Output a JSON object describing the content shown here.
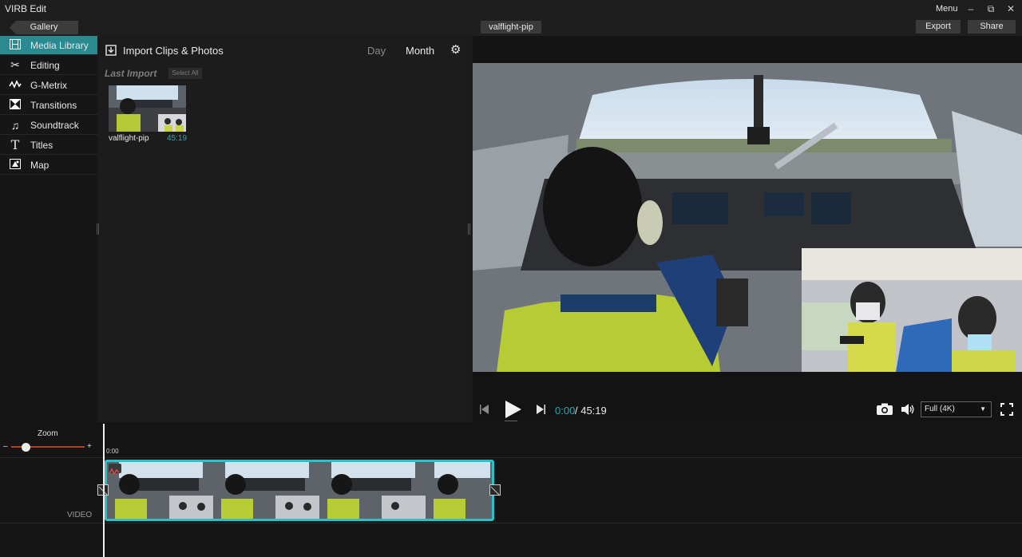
{
  "app": {
    "title": "VIRB Edit",
    "menu_label": "Menu"
  },
  "window_controls": {
    "minimize": "–",
    "restore": "⧉",
    "close": "✕"
  },
  "topbar": {
    "gallery_label": "Gallery",
    "project_title": "valflight-pip",
    "export_label": "Export",
    "share_label": "Share"
  },
  "sidebar": {
    "items": [
      {
        "label": "Media Library",
        "icon": "film-icon",
        "glyph": "▤",
        "active": true
      },
      {
        "label": "Editing",
        "icon": "scissors-icon",
        "glyph": "✂",
        "active": false
      },
      {
        "label": "G-Metrix",
        "icon": "gauge-icon",
        "glyph": "〰",
        "active": false
      },
      {
        "label": "Transitions",
        "icon": "transitions-icon",
        "glyph": "⧗",
        "active": false
      },
      {
        "label": "Soundtrack",
        "icon": "music-note-icon",
        "glyph": "♫",
        "active": false
      },
      {
        "label": "Titles",
        "icon": "text-icon",
        "glyph": "T",
        "active": false
      },
      {
        "label": "Map",
        "icon": "map-icon",
        "glyph": "◪",
        "active": false
      }
    ]
  },
  "library": {
    "import_label": "Import Clips & Photos",
    "day_tab": "Day",
    "month_tab": "Month",
    "section_heading": "Last Import",
    "select_all_label": "Select All",
    "clips": [
      {
        "name": "valflight-pip",
        "duration": "45:19"
      }
    ]
  },
  "player": {
    "time_current": "0:00",
    "time_separator_total": "/ 45:19",
    "quality": "Full (4K)"
  },
  "timeline": {
    "zoom_label": "Zoom",
    "zoom_minus": "–",
    "zoom_plus": "+",
    "zoom_level": 0.14,
    "ruler_start": "0:00",
    "track_label": "VIDEO"
  },
  "colors": {
    "accent": "#2a8a90",
    "time_current": "#2fa6b0",
    "clip_border": "#2cc0c8",
    "zoom_track": "#b84018"
  }
}
